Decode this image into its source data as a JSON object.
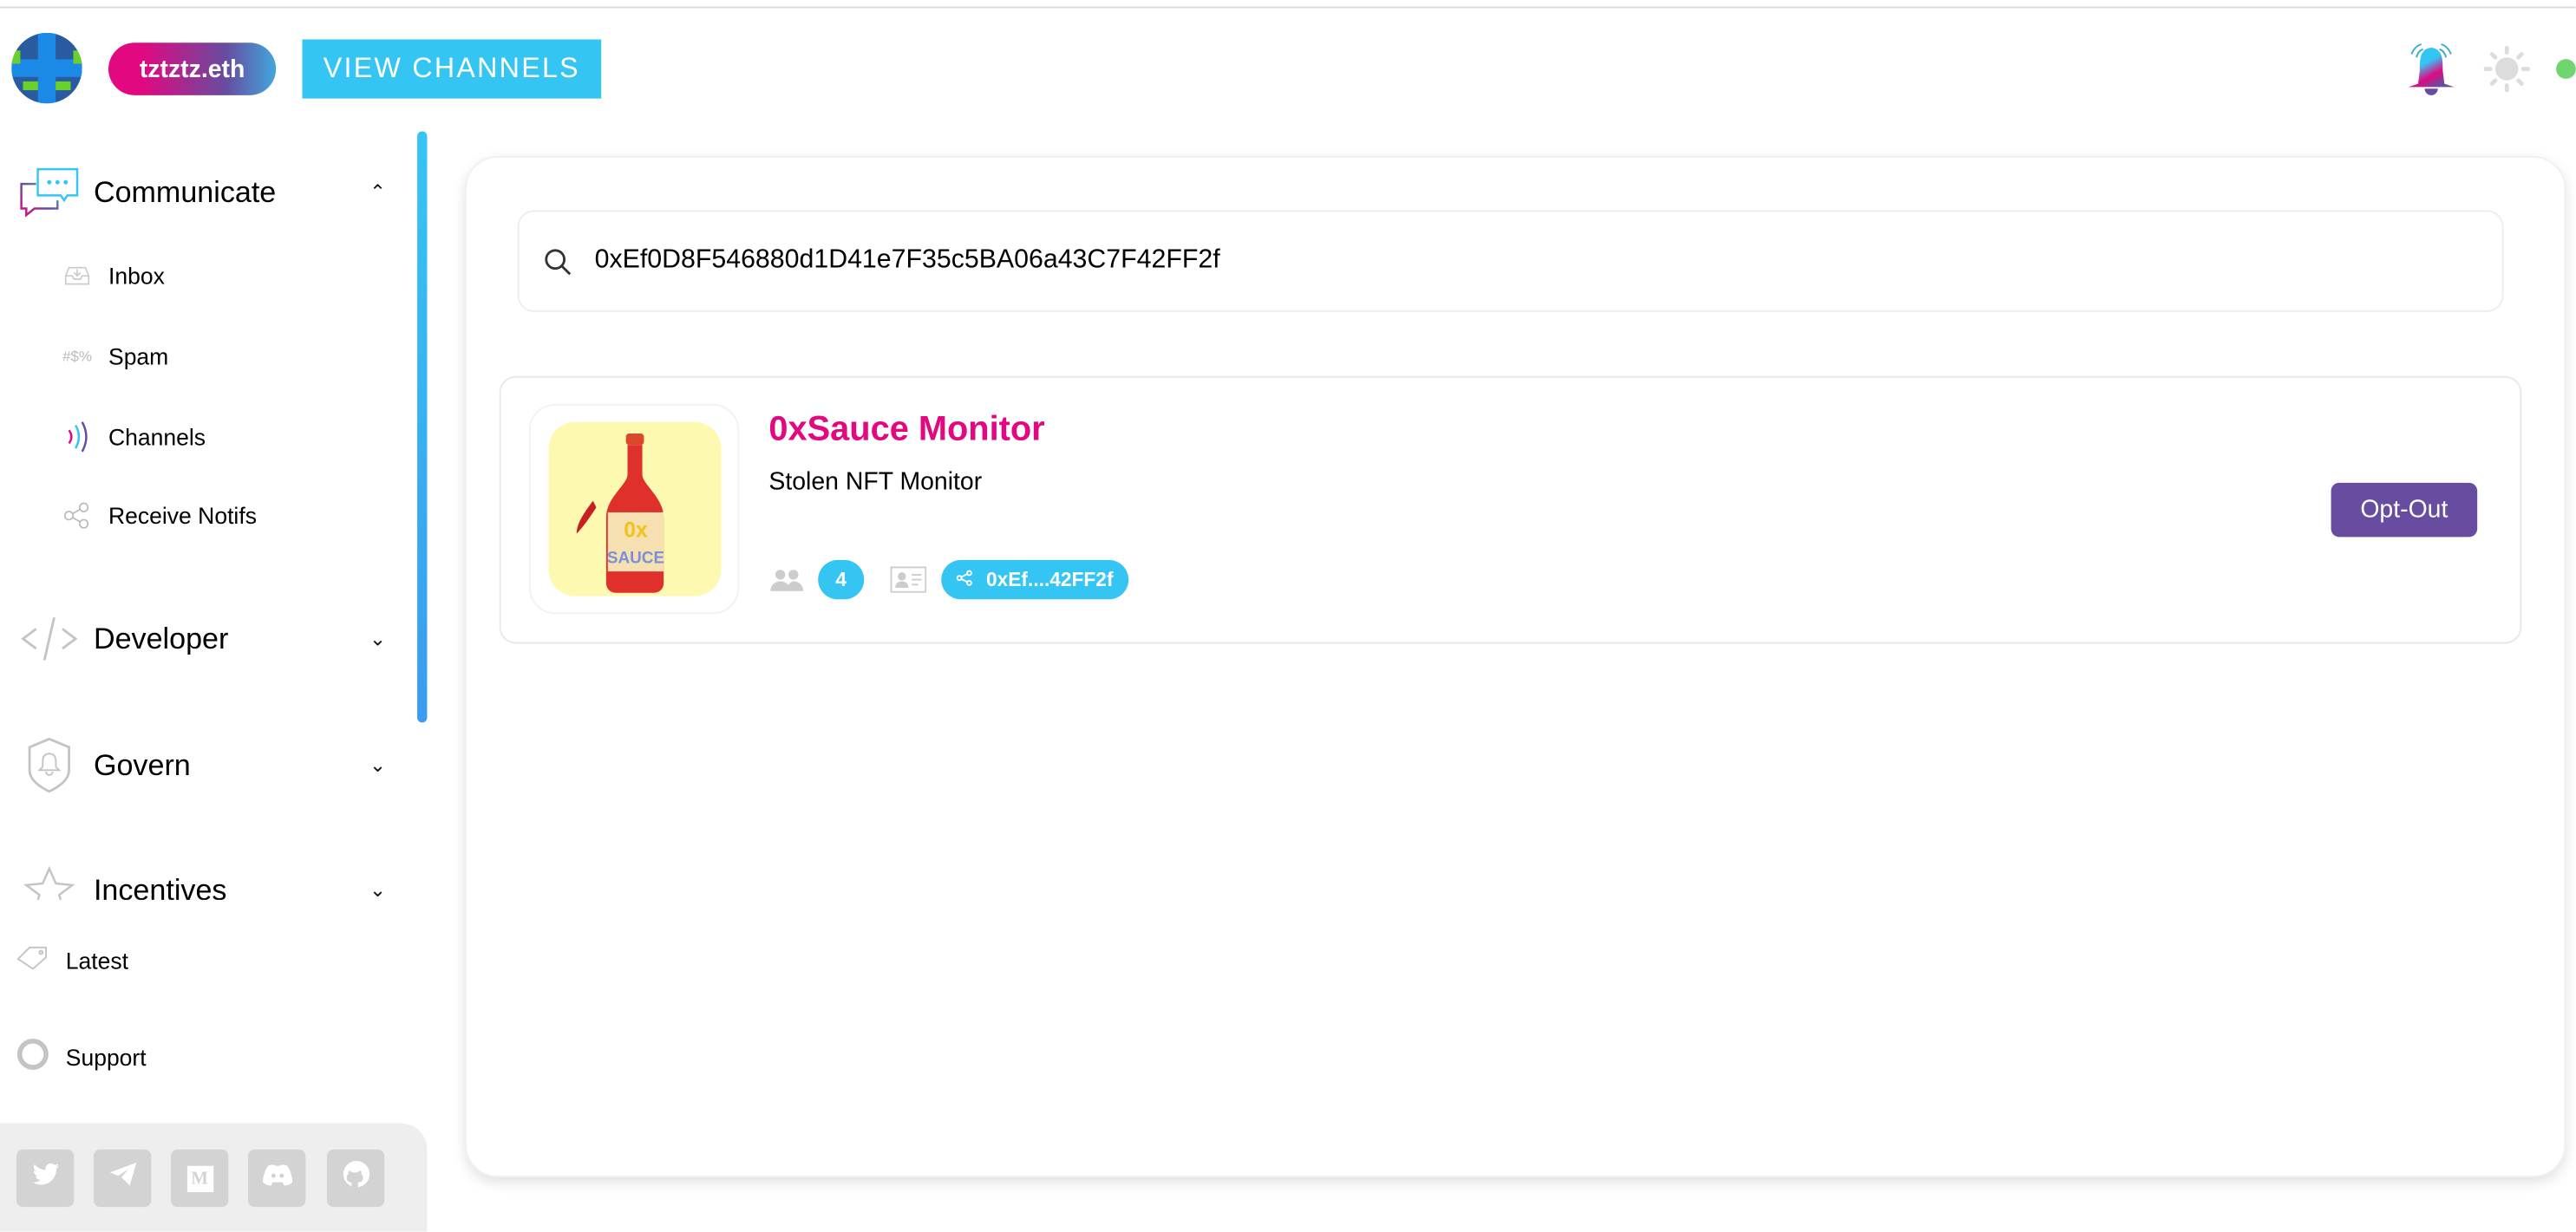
{
  "header": {
    "user_label": "tztztz.eth",
    "view_channels_label": "VIEW CHANNELS",
    "icons": [
      "avatar",
      "bell-icon",
      "sun-icon",
      "status-dot"
    ],
    "status_color": "#6fd66f"
  },
  "sidebar": {
    "sections": [
      {
        "label": "Communicate",
        "icon": "chat-bubbles-icon",
        "expanded": true,
        "items": [
          {
            "label": "Inbox",
            "icon": "inbox-icon"
          },
          {
            "label": "Spam",
            "icon": "spam-icon",
            "glyph": "#$%"
          },
          {
            "label": "Channels",
            "icon": "channels-icon"
          },
          {
            "label": "Receive Notifs",
            "icon": "share-icon"
          }
        ]
      },
      {
        "label": "Developer",
        "icon": "code-icon",
        "expanded": false
      },
      {
        "label": "Govern",
        "icon": "shield-bell-icon",
        "expanded": false
      },
      {
        "label": "Incentives",
        "icon": "star-icon",
        "expanded": false
      }
    ],
    "links": [
      {
        "label": "Latest",
        "icon": "tag-icon"
      },
      {
        "label": "Support",
        "icon": "lifebuoy-icon"
      }
    ],
    "social": [
      "twitter-icon",
      "telegram-icon",
      "medium-icon",
      "discord-icon",
      "github-icon"
    ]
  },
  "main": {
    "search_value": "0xEf0D8F546880d1D41e7F35c5BA06a43C7F42FF2f",
    "channel": {
      "name": "0xSauce Monitor",
      "description": "Stolen NFT Monitor",
      "subscribers": "4",
      "address_short": "0xEf....42FF2f",
      "logo_text": "0x SAUCE",
      "action_label": "Opt-Out"
    }
  },
  "colors": {
    "brand_pink": "#e20880",
    "brand_purple": "#674c9f",
    "brand_blue": "#35c5f3"
  }
}
